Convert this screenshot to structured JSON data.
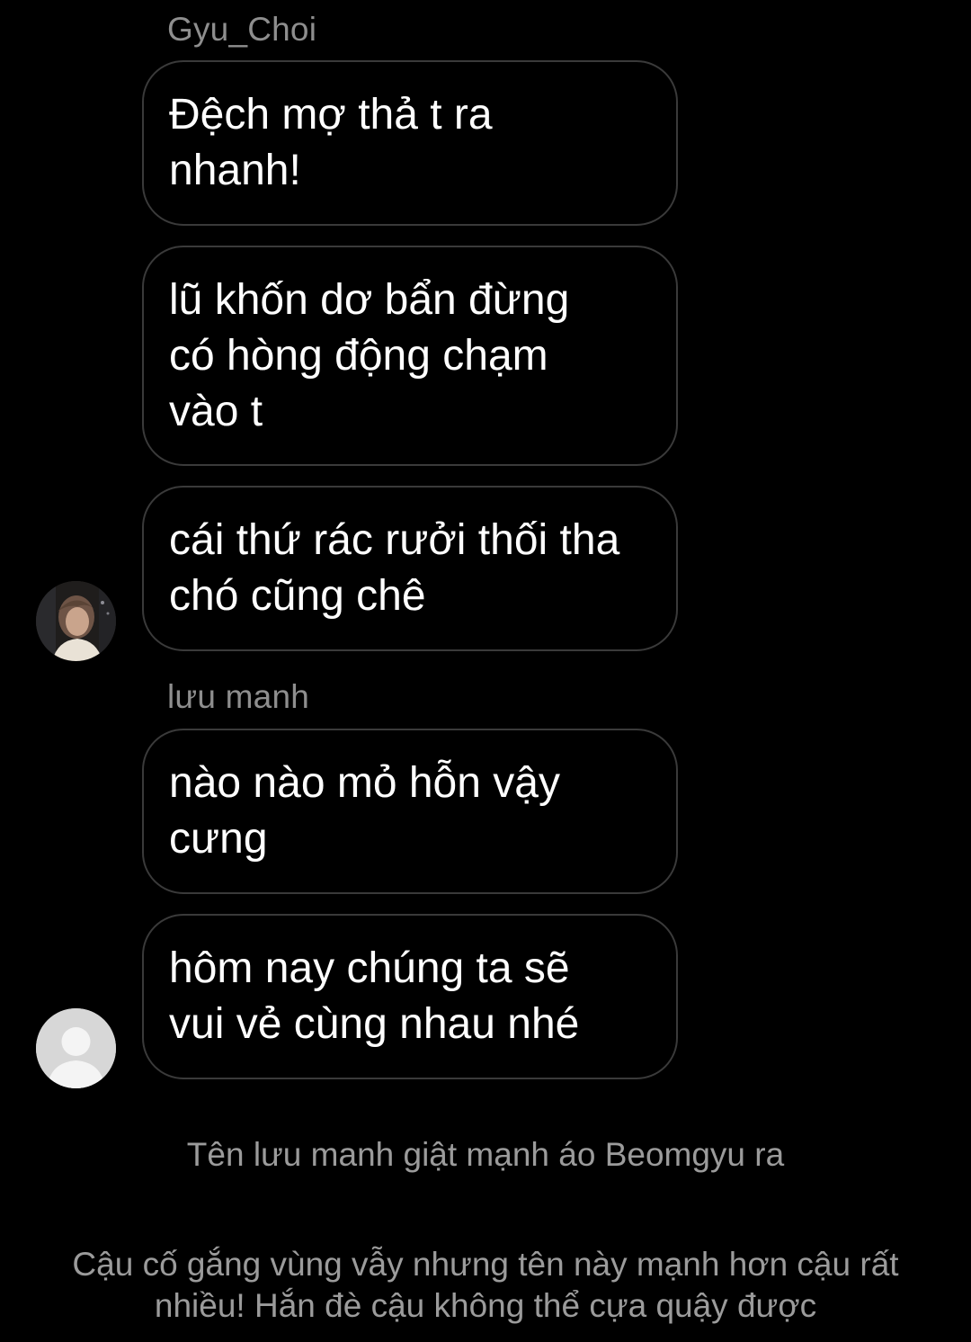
{
  "conversation": {
    "groups": [
      {
        "sender": "Gyu_Choi",
        "avatar_icon": "user-photo-avatar-icon",
        "messages": [
          "Đệch mợ thả t ra\nnhanh!",
          "lũ khốn dơ bẩn đừng\ncó hòng động chạm\nvào t",
          "cái thứ rác rưởi thối tha\nchó cũng chê"
        ]
      },
      {
        "sender": "lưu manh",
        "avatar_icon": "default-user-avatar-icon",
        "messages": [
          "nào nào mỏ hỗn vậy\ncưng",
          "hôm nay chúng ta sẽ\nvui vẻ cùng nhau nhé"
        ]
      }
    ]
  },
  "narrations": [
    "Tên lưu manh giật mạnh áo Beomgyu ra",
    "Cậu cố gắng vùng vẫy nhưng tên này mạnh hơn cậu rất\nnhiều! Hắn đè cậu không thể cựa quậy được"
  ],
  "colors": {
    "background": "#000000",
    "bubble_border": "#3a3a3a",
    "message_text": "#ffffff",
    "sender_name": "#8e8e8e",
    "narration_text": "#9b9b9b"
  }
}
